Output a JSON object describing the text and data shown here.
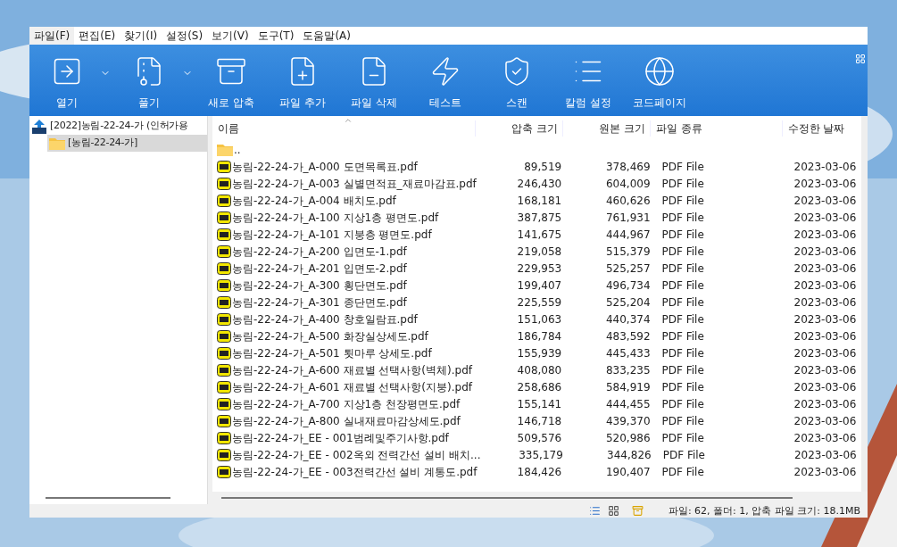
{
  "menu": [
    {
      "label": "파일(F)",
      "selected": true
    },
    {
      "label": "편집(E)",
      "selected": false
    },
    {
      "label": "찾기(I)",
      "selected": false
    },
    {
      "label": "설정(S)",
      "selected": false
    },
    {
      "label": "보기(V)",
      "selected": false
    },
    {
      "label": "도구(T)",
      "selected": false
    },
    {
      "label": "도움말(A)",
      "selected": false
    }
  ],
  "toolbar": [
    {
      "kind": "open",
      "label": "열기",
      "dropdown": true
    },
    {
      "kind": "extract",
      "label": "풀기",
      "dropdown": true
    },
    {
      "kind": "new",
      "label": "새로 압축",
      "dropdown": false
    },
    {
      "kind": "add",
      "label": "파일 추가",
      "dropdown": false
    },
    {
      "kind": "delete",
      "label": "파일 삭제",
      "dropdown": false
    },
    {
      "kind": "test",
      "label": "테스트",
      "dropdown": false
    },
    {
      "kind": "scan",
      "label": "스캔",
      "dropdown": false
    },
    {
      "kind": "columns",
      "label": "칼럼 설정",
      "dropdown": false
    },
    {
      "kind": "codepage",
      "label": "코드페이지",
      "dropdown": false
    }
  ],
  "tree": [
    {
      "kind": "zip",
      "label": "[2022]농림-22-24-가 (인허가용",
      "selected": false,
      "children": [
        {
          "kind": "folder",
          "label": "[농림-22-24-가]",
          "selected": true
        }
      ]
    }
  ],
  "table": {
    "columns": [
      "이름",
      "압축 크기",
      "원본 크기",
      "파일 종류",
      "수정한 날짜"
    ],
    "rows": [
      {
        "kind": "folder",
        "name": ".."
      },
      {
        "kind": "pdf",
        "name": "농림-22-24-가_A-000 도면목록표.pdf",
        "packed": "89,519",
        "size": "378,469",
        "type": "PDF File",
        "date": "2023-03-06"
      },
      {
        "kind": "pdf",
        "name": "농림-22-24-가_A-003 실별면적표_재료마감표.pdf",
        "packed": "246,430",
        "size": "604,009",
        "type": "PDF File",
        "date": "2023-03-06"
      },
      {
        "kind": "pdf",
        "name": "농림-22-24-가_A-004 배치도.pdf",
        "packed": "168,181",
        "size": "460,626",
        "type": "PDF File",
        "date": "2023-03-06"
      },
      {
        "kind": "pdf",
        "name": "농림-22-24-가_A-100 지상1층 평면도.pdf",
        "packed": "387,875",
        "size": "761,931",
        "type": "PDF File",
        "date": "2023-03-06"
      },
      {
        "kind": "pdf",
        "name": "농림-22-24-가_A-101 지붕층 평면도.pdf",
        "packed": "141,675",
        "size": "444,967",
        "type": "PDF File",
        "date": "2023-03-06"
      },
      {
        "kind": "pdf",
        "name": "농림-22-24-가_A-200 입면도-1.pdf",
        "packed": "219,058",
        "size": "515,379",
        "type": "PDF File",
        "date": "2023-03-06"
      },
      {
        "kind": "pdf",
        "name": "농림-22-24-가_A-201 입면도-2.pdf",
        "packed": "229,953",
        "size": "525,257",
        "type": "PDF File",
        "date": "2023-03-06"
      },
      {
        "kind": "pdf",
        "name": "농림-22-24-가_A-300 횡단면도.pdf",
        "packed": "199,407",
        "size": "496,734",
        "type": "PDF File",
        "date": "2023-03-06"
      },
      {
        "kind": "pdf",
        "name": "농림-22-24-가_A-301 종단면도.pdf",
        "packed": "225,559",
        "size": "525,204",
        "type": "PDF File",
        "date": "2023-03-06"
      },
      {
        "kind": "pdf",
        "name": "농림-22-24-가_A-400 창호일람표.pdf",
        "packed": "151,063",
        "size": "440,374",
        "type": "PDF File",
        "date": "2023-03-06"
      },
      {
        "kind": "pdf",
        "name": "농림-22-24-가_A-500 화장실상세도.pdf",
        "packed": "186,784",
        "size": "483,592",
        "type": "PDF File",
        "date": "2023-03-06"
      },
      {
        "kind": "pdf",
        "name": "농림-22-24-가_A-501 툇마루 상세도.pdf",
        "packed": "155,939",
        "size": "445,433",
        "type": "PDF File",
        "date": "2023-03-06"
      },
      {
        "kind": "pdf",
        "name": "농림-22-24-가_A-600 재료별 선택사항(벽체).pdf",
        "packed": "408,080",
        "size": "833,235",
        "type": "PDF File",
        "date": "2023-03-06"
      },
      {
        "kind": "pdf",
        "name": "농림-22-24-가_A-601 재료별 선택사항(지붕).pdf",
        "packed": "258,686",
        "size": "584,919",
        "type": "PDF File",
        "date": "2023-03-06"
      },
      {
        "kind": "pdf",
        "name": "농림-22-24-가_A-700 지상1층 천장평면도.pdf",
        "packed": "155,141",
        "size": "444,455",
        "type": "PDF File",
        "date": "2023-03-06"
      },
      {
        "kind": "pdf",
        "name": "농림-22-24-가_A-800 실내재료마감상세도.pdf",
        "packed": "146,718",
        "size": "439,370",
        "type": "PDF File",
        "date": "2023-03-06"
      },
      {
        "kind": "pdf",
        "name": "농림-22-24-가_EE - 001범례및주기사항.pdf",
        "packed": "509,576",
        "size": "520,986",
        "type": "PDF File",
        "date": "2023-03-06"
      },
      {
        "kind": "pdf",
        "name": "농림-22-24-가_EE - 002옥외 전력간선 설비 배치...",
        "packed": "335,179",
        "size": "344,826",
        "type": "PDF File",
        "date": "2023-03-06"
      },
      {
        "kind": "pdf",
        "name": "농림-22-24-가_EE - 003전력간선 설비 계통도.pdf",
        "packed": "184,426",
        "size": "190,407",
        "type": "PDF File",
        "date": "2023-03-06"
      }
    ]
  },
  "status_bar": "파일: 62, 폴더: 1, 압축 파일 크기: 18.1MB"
}
